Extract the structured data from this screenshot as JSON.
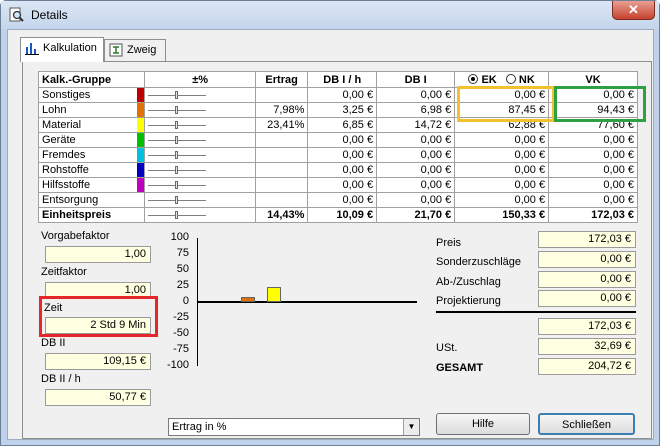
{
  "window": {
    "title": "Details",
    "close_label": "✕"
  },
  "tabs": [
    {
      "label": "Kalkulation"
    },
    {
      "label": "Zweig"
    }
  ],
  "grid": {
    "headers": {
      "gruppe": "Kalk.-Gruppe",
      "pct": "±%",
      "ertrag": "Ertrag",
      "db1h": "DB I / h",
      "db1": "DB I",
      "ek": "EK",
      "nk": "NK",
      "vk": "VK"
    },
    "rows": [
      {
        "name": "Sonstiges",
        "color": "#c00000",
        "ertrag": "",
        "db1h": "0,00 €",
        "db1": "0,00 €",
        "ek": "0,00 €",
        "vk": "0,00 €"
      },
      {
        "name": "Lohn",
        "color": "#e07000",
        "ertrag": "7,98%",
        "db1h": "3,25 €",
        "db1": "6,98 €",
        "ek": "87,45 €",
        "vk": "94,43 €"
      },
      {
        "name": "Material",
        "color": "#ffff00",
        "ertrag": "23,41%",
        "db1h": "6,85 €",
        "db1": "14,72 €",
        "ek": "62,88 €",
        "vk": "77,60 €"
      },
      {
        "name": "Geräte",
        "color": "#00c000",
        "ertrag": "",
        "db1h": "0,00 €",
        "db1": "0,00 €",
        "ek": "0,00 €",
        "vk": "0,00 €"
      },
      {
        "name": "Fremdes",
        "color": "#00c0e0",
        "ertrag": "",
        "db1h": "0,00 €",
        "db1": "0,00 €",
        "ek": "0,00 €",
        "vk": "0,00 €"
      },
      {
        "name": "Rohstoffe",
        "color": "#0000c0",
        "ertrag": "",
        "db1h": "0,00 €",
        "db1": "0,00 €",
        "ek": "0,00 €",
        "vk": "0,00 €"
      },
      {
        "name": "Hilfsstoffe",
        "color": "#c000c0",
        "ertrag": "",
        "db1h": "0,00 €",
        "db1": "0,00 €",
        "ek": "0,00 €",
        "vk": "0,00 €"
      },
      {
        "name": "Entsorgung",
        "color": "",
        "ertrag": "",
        "db1h": "0,00 €",
        "db1": "0,00 €",
        "ek": "0,00 €",
        "vk": "0,00 €"
      },
      {
        "name": "Einheitspreis",
        "color": "",
        "ertrag": "14,43%",
        "db1h": "10,09 €",
        "db1": "21,70 €",
        "ek": "150,33 €",
        "vk": "172,03 €"
      }
    ]
  },
  "left": {
    "vorgabefaktor_label": "Vorgabefaktor",
    "vorgabefaktor": "1,00",
    "zeitfaktor_label": "Zeitfaktor",
    "zeitfaktor": "1,00",
    "zeit_label": "Zeit",
    "zeit": "2 Std 9 Min",
    "db2_label": "DB II",
    "db2": "109,15 €",
    "db2h_label": "DB II / h",
    "db2h": "50,77 €"
  },
  "chart_data": {
    "type": "bar",
    "y_ticks": [
      "100",
      "75",
      "50",
      "25",
      "0",
      "-25",
      "-50",
      "-75",
      "-100"
    ],
    "ylim": [
      -100,
      100
    ],
    "categories": [
      "Sonstiges",
      "Lohn",
      "Material",
      "Geräte",
      "Fremdes",
      "Rohstoffe",
      "Hilfsstoffe",
      "Entsorgung"
    ],
    "values": [
      0,
      7.98,
      23.41,
      0,
      0,
      0,
      0,
      0
    ],
    "colors": [
      "#c00000",
      "#e07000",
      "#ffff00",
      "#00c000",
      "#00c0e0",
      "#0000c0",
      "#c000c0",
      "#808080"
    ]
  },
  "chart_select": {
    "value": "Ertrag in %"
  },
  "right": {
    "preis_label": "Preis",
    "preis": "172,03 €",
    "sonder_label": "Sonderzuschläge",
    "sonder": "0,00 €",
    "abzu_label": "Ab-/Zuschlag",
    "abzu": "0,00 €",
    "proj_label": "Projektierung",
    "proj": "0,00 €",
    "netto": "172,03 €",
    "ust_label": "USt.",
    "ust": "32,69 €",
    "gesamt_label": "GESAMT",
    "gesamt": "204,72 €"
  },
  "buttons": {
    "hilfe": "Hilfe",
    "schliessen": "Schließen"
  }
}
